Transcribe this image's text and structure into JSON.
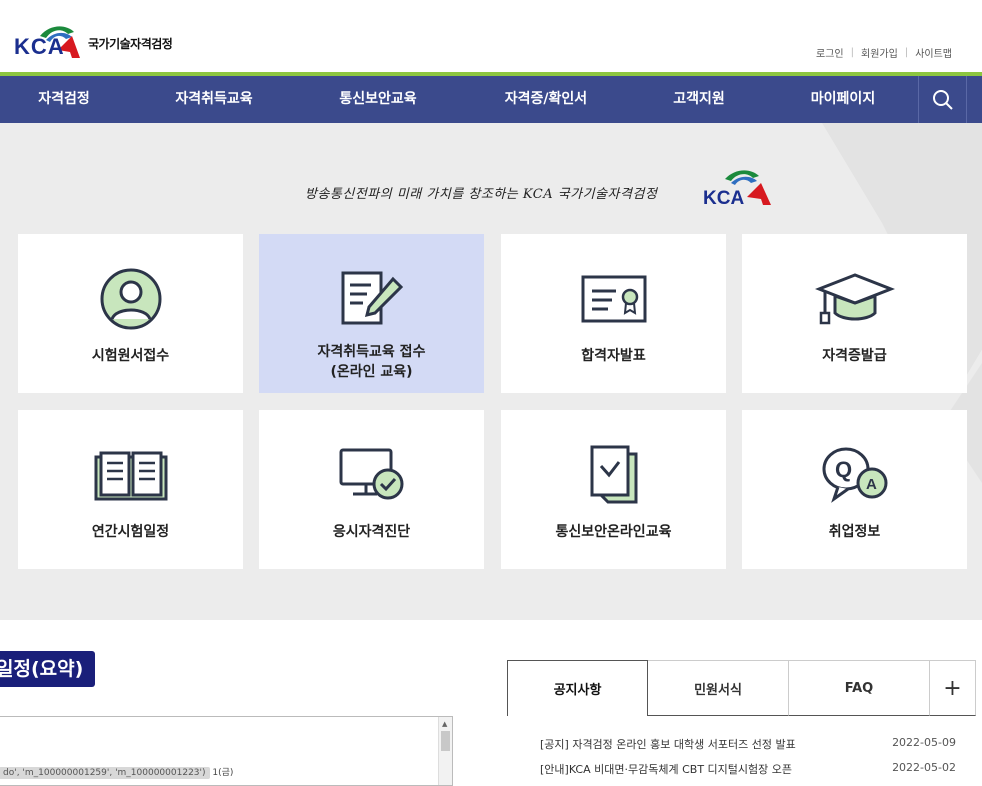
{
  "header": {
    "logo_text": "KCA",
    "logo_sub": "국가기술자격검정",
    "util_links": [
      "로그인",
      "회원가입",
      "사이트맵"
    ]
  },
  "nav": {
    "items": [
      "자격검정",
      "자격취득교육",
      "통신보안교육",
      "자격증/확인서",
      "고객지원",
      "마이페이지"
    ],
    "search_icon": "search-icon"
  },
  "hero": {
    "slogan": "방송통신전파의 미래 가치를 창조하는 KCA 국가기술자격검정",
    "slogan_logo": "KCA",
    "cards": [
      {
        "label": "시험원서접수",
        "icon": "user-icon"
      },
      {
        "label": "자격취득교육 접수",
        "label2": "(온라인 교육)",
        "icon": "document-pen-icon"
      },
      {
        "label": "합격자발표",
        "icon": "certificate-icon"
      },
      {
        "label": "자격증발급",
        "icon": "graduation-cap-icon"
      },
      {
        "label": "연간시험일정",
        "icon": "open-book-icon"
      },
      {
        "label": "응시자격진단",
        "icon": "monitor-check-icon"
      },
      {
        "label": "통신보안온라인교육",
        "icon": "document-check-icon"
      },
      {
        "label": "취업정보",
        "icon": "qa-bubble-icon"
      }
    ]
  },
  "schedule": {
    "title": "일정(요약)",
    "snippet_chip": "do', 'm_100000001259', 'm_100000001223')",
    "snippet_tail": "1(금)"
  },
  "board": {
    "tabs": [
      "공지사항",
      "민원서식",
      "FAQ",
      "+"
    ],
    "notices": [
      {
        "title": "[공지] 자격검정 온라인 홍보 대학생 서포터즈 선정 발표",
        "date": "2022-05-09"
      },
      {
        "title": "[안내]KCA 비대면·무감독체계 CBT 디지털시험장 오픈",
        "date": "2022-05-02"
      }
    ]
  },
  "colors": {
    "nav_bg": "#3b4a8c",
    "accent_green": "#8cc63f",
    "hero_bg": "#ececec",
    "active_card": "#d3daf5",
    "schedule_title_bg": "#1a1f7a"
  }
}
